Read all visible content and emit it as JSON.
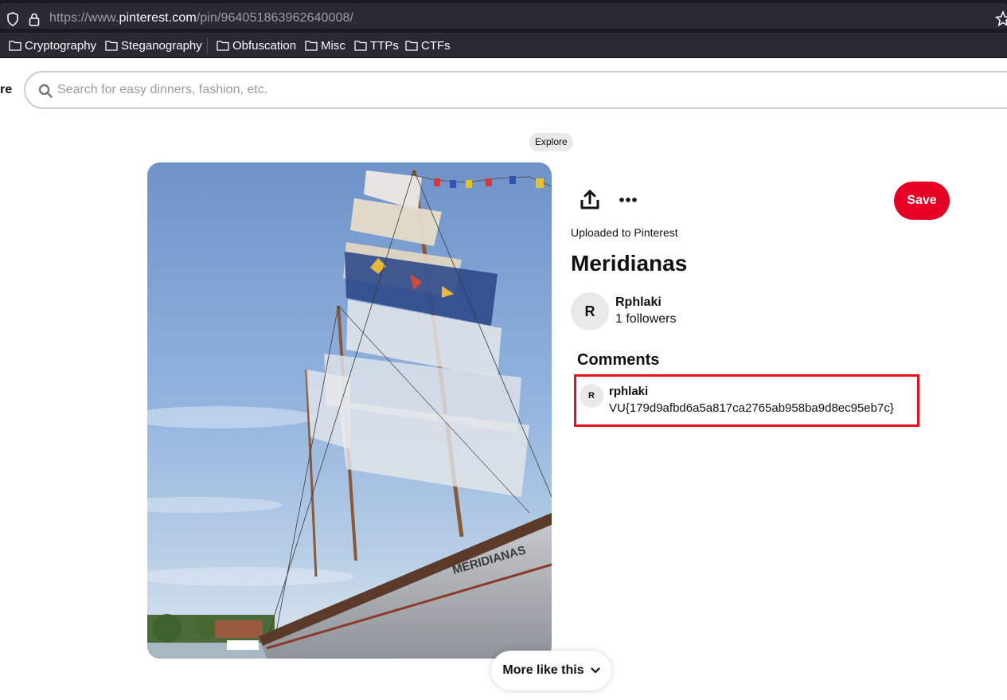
{
  "browser": {
    "url_prefix": "https://www.",
    "url_host": "pinterest.com",
    "url_path": "/pin/964051863962640008/",
    "bookmarks": [
      "Cryptography",
      "Steganography",
      "Obfuscation",
      "Misc",
      "TTPs",
      "CTFs"
    ]
  },
  "header": {
    "nav_partial": "re",
    "search_placeholder": "Search for easy dinners, fashion, etc."
  },
  "breadcrumb": {
    "label": "Explore"
  },
  "pin": {
    "uploaded_label": "Uploaded to Pinterest",
    "title": "Meridianas",
    "image_hull_text": "MERIDIANAS",
    "save_label": "Save",
    "author": {
      "initial": "R",
      "name": "Rphlaki",
      "followers": "1 followers"
    }
  },
  "comments": {
    "heading": "Comments",
    "items": [
      {
        "initial": "R",
        "user": "rphlaki",
        "text": "VU{179d9afbd6a5a817ca2765ab958ba9d8ec95eb7c}"
      }
    ]
  },
  "footer": {
    "more_like_label": "More like this"
  },
  "colors": {
    "save": "#e60023",
    "highlight": "#e8111a",
    "chip": "#e9e9e9"
  }
}
